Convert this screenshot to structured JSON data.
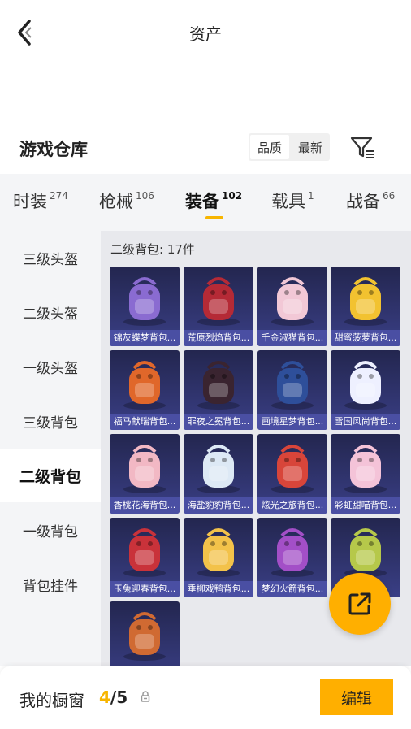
{
  "header": {
    "title": "资产",
    "back_icon": "chevron-left-icon"
  },
  "section": {
    "title": "游戏仓库",
    "sort_options": [
      "品质",
      "最新"
    ],
    "sort_selected": "品质",
    "filter_icon": "filter-icon"
  },
  "tabs": [
    {
      "label": "时装",
      "count": "274"
    },
    {
      "label": "枪械",
      "count": "106"
    },
    {
      "label": "装备",
      "count": "102",
      "active": true
    },
    {
      "label": "载具",
      "count": "1"
    },
    {
      "label": "战备",
      "count": "66"
    }
  ],
  "sidebar": [
    {
      "label": "三级头盔"
    },
    {
      "label": "二级头盔"
    },
    {
      "label": "一级头盔"
    },
    {
      "label": "三级背包"
    },
    {
      "label": "二级背包",
      "active": true
    },
    {
      "label": "一级背包"
    },
    {
      "label": "背包挂件"
    }
  ],
  "content": {
    "group_label": "二级背包: 17件",
    "items": [
      {
        "name": "锦灰蝶梦背包...",
        "color": "#8a6bd1"
      },
      {
        "name": "荒原烈焰背包...",
        "color": "#b52a36"
      },
      {
        "name": "千金淑猫背包...",
        "color": "#f2c8d6"
      },
      {
        "name": "甜蜜菠萝背包...",
        "color": "#f2c230"
      },
      {
        "name": "福马献瑞背包...",
        "color": "#e0672a"
      },
      {
        "name": "罪夜之冕背包...",
        "color": "#3a2430"
      },
      {
        "name": "画境星梦背包...",
        "color": "#2e4f9a"
      },
      {
        "name": "雪国风尚背包...",
        "color": "#eef0ff"
      },
      {
        "name": "香桃花海背包...",
        "color": "#f2b8c4"
      },
      {
        "name": "海盐豹豹背包...",
        "color": "#dde9f5"
      },
      {
        "name": "炫光之旅背包...",
        "color": "#d8453a"
      },
      {
        "name": "彩虹甜喵背包...",
        "color": "#f4c3d8"
      },
      {
        "name": "玉兔迎春背包...",
        "color": "#c9323a"
      },
      {
        "name": "垂柳戏鸭背包...",
        "color": "#f3c24a"
      },
      {
        "name": "梦幻火箭背包...",
        "color": "#a34fc7"
      },
      {
        "name": "",
        "color": "#b6c84a"
      },
      {
        "name": "",
        "color": "#d06a32"
      }
    ]
  },
  "fab": {
    "icon": "share-external-icon"
  },
  "footer": {
    "label": "我的橱窗",
    "count_current": "4",
    "count_sep_total": "/5",
    "lock_icon": "lock-icon",
    "edit_label": "编辑"
  }
}
